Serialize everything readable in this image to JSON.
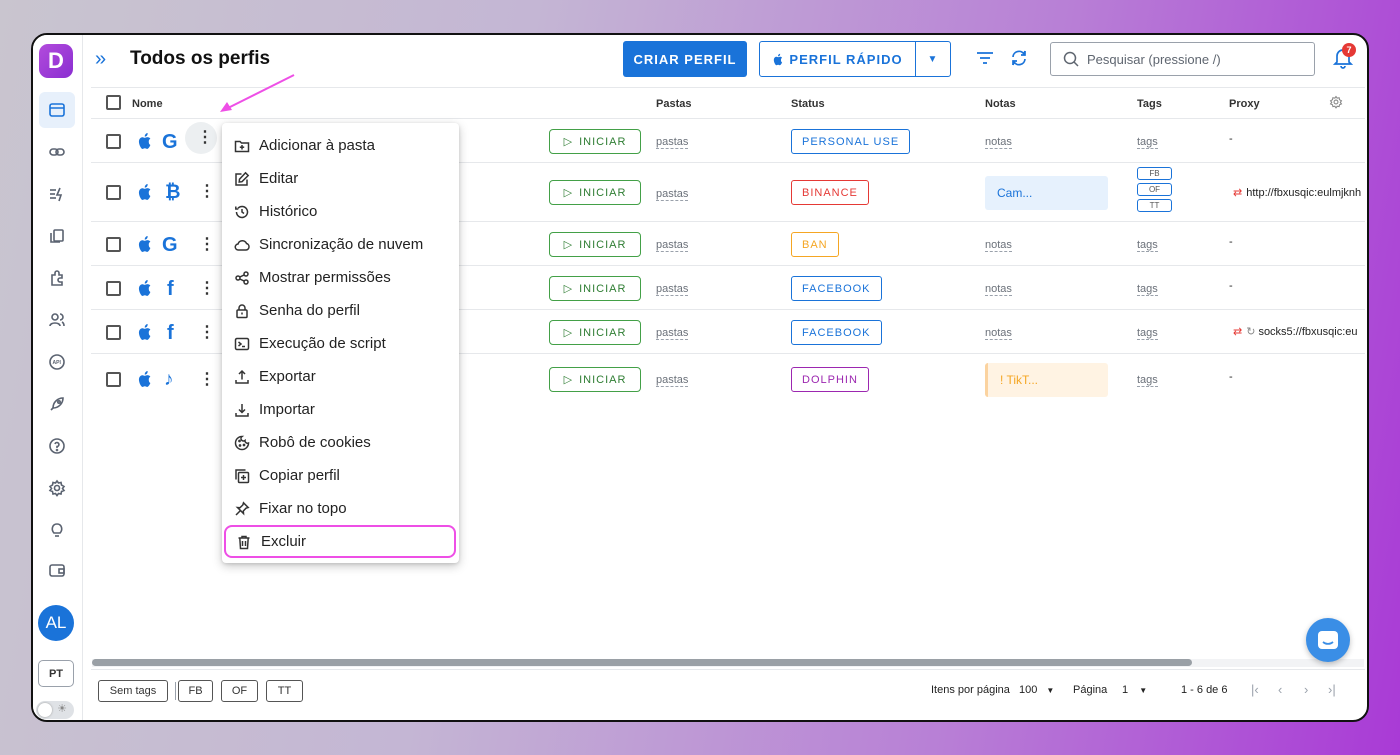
{
  "header": {
    "expand_icon": "»",
    "title": "Todos os perfis",
    "create_button": "CRIAR PERFIL",
    "quick_button": "PERFIL RÁPIDO",
    "search_placeholder": "Pesquisar (pressione /)",
    "notification_count": "7"
  },
  "sidebar": {
    "logo": "D",
    "avatar": "AL",
    "language": "PT",
    "icons": [
      "browser-icon",
      "link-icon",
      "automation-icon",
      "copy-icon",
      "extension-icon",
      "users-icon",
      "api-icon",
      "rocket-icon",
      "help-icon",
      "settings-icon",
      "lightbulb-icon",
      "wallet-icon"
    ]
  },
  "table": {
    "columns": [
      "Nome",
      "Pastas",
      "Status",
      "Notas",
      "Tags",
      "Proxy"
    ],
    "start_label": "INICIAR",
    "pastas_label": "pastas",
    "rows": [
      {
        "brand": "G",
        "status": "PERSONAL USE",
        "status_color": "#1a73d9",
        "notes": "notas",
        "tags": "tags",
        "proxy": "-"
      },
      {
        "brand": "₿",
        "status": "BINANCE",
        "status_color": "#e53935",
        "notes": "Cam...",
        "tags_chips": [
          "FB",
          "OF",
          "TT"
        ],
        "proxy": "http://fbxusqic:eulmjknh"
      },
      {
        "brand": "G",
        "status": "BAN",
        "status_color": "#f5a623",
        "notes": "notas",
        "tags": "tags",
        "proxy": "-"
      },
      {
        "brand": "f",
        "status": "FACEBOOK",
        "status_color": "#1a73d9",
        "notes": "notas",
        "tags": "tags",
        "proxy": "-"
      },
      {
        "brand": "f",
        "status": "FACEBOOK",
        "status_color": "#1a73d9",
        "notes": "notas",
        "tags": "tags",
        "proxy": "socks5://fbxusqic:eu"
      },
      {
        "brand": "♪",
        "status": "DOLPHIN",
        "status_color": "#9c27b0",
        "notes": "! TikT...",
        "tags": "tags",
        "proxy": "-"
      }
    ]
  },
  "context_menu": {
    "items": [
      {
        "label": "Adicionar à pasta",
        "icon": "folder-add-icon"
      },
      {
        "label": "Editar",
        "icon": "edit-icon"
      },
      {
        "label": "Histórico",
        "icon": "history-icon"
      },
      {
        "label": "Sincronização de nuvem",
        "icon": "cloud-icon"
      },
      {
        "label": "Mostrar permissões",
        "icon": "share-icon"
      },
      {
        "label": "Senha do perfil",
        "icon": "lock-icon"
      },
      {
        "label": "Execução de script",
        "icon": "terminal-icon"
      },
      {
        "label": "Exportar",
        "icon": "export-icon"
      },
      {
        "label": "Importar",
        "icon": "import-icon"
      },
      {
        "label": "Robô de cookies",
        "icon": "cookie-icon"
      },
      {
        "label": "Copiar perfil",
        "icon": "copy-icon"
      },
      {
        "label": "Fixar no topo",
        "icon": "pin-icon"
      },
      {
        "label": "Excluir",
        "icon": "trash-icon"
      }
    ]
  },
  "footer": {
    "tag_filters": [
      "Sem tags",
      "FB",
      "OF",
      "TT"
    ],
    "items_per_page_label": "Itens por página",
    "items_per_page": "100",
    "page_label": "Página",
    "page": "1",
    "range": "1 - 6 de 6"
  }
}
